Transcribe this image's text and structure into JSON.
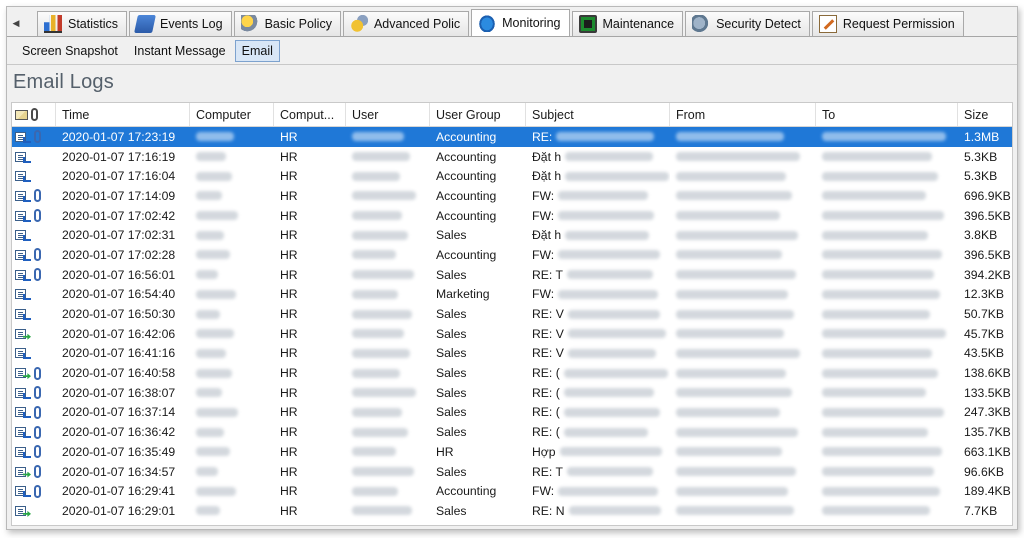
{
  "tabs": [
    {
      "label": "Statistics",
      "icon": "statistics-icon"
    },
    {
      "label": "Events Log",
      "icon": "events-log-icon"
    },
    {
      "label": "Basic Policy",
      "icon": "basic-policy-icon"
    },
    {
      "label": "Advanced Polic",
      "icon": "advanced-policy-icon"
    },
    {
      "label": "Monitoring",
      "icon": "monitoring-icon",
      "active": true
    },
    {
      "label": "Maintenance",
      "icon": "maintenance-icon"
    },
    {
      "label": "Security Detect",
      "icon": "security-detect-icon"
    },
    {
      "label": "Request Permission",
      "icon": "request-permission-icon"
    }
  ],
  "subtabs": [
    {
      "label": "Screen Snapshot"
    },
    {
      "label": "Instant Message"
    },
    {
      "label": "Email",
      "active": true
    }
  ],
  "title": "Email Logs",
  "columns": {
    "time": "Time",
    "computer": "Computer",
    "computer2": "Comput...",
    "user": "User",
    "group": "User Group",
    "subject": "Subject",
    "from": "From",
    "to": "To",
    "size": "Size"
  },
  "rows": [
    {
      "time": "2020-01-07 17:23:19",
      "computer2": "HR",
      "group": "Accounting",
      "subject_prefix": "RE: ",
      "size": "1.3MB",
      "direction": "in",
      "attachment": true,
      "selected": true
    },
    {
      "time": "2020-01-07 17:16:19",
      "computer2": "HR",
      "group": "Accounting",
      "subject_prefix": "Đặt h",
      "size": "5.3KB",
      "direction": "in",
      "attachment": false
    },
    {
      "time": "2020-01-07 17:16:04",
      "computer2": "HR",
      "group": "Accounting",
      "subject_prefix": "Đặt h",
      "size": "5.3KB",
      "direction": "in",
      "attachment": false
    },
    {
      "time": "2020-01-07 17:14:09",
      "computer2": "HR",
      "group": "Accounting",
      "subject_prefix": "FW: ",
      "size": "696.9KB",
      "direction": "in",
      "attachment": true
    },
    {
      "time": "2020-01-07 17:02:42",
      "computer2": "HR",
      "group": "Accounting",
      "subject_prefix": "FW: ",
      "size": "396.5KB",
      "direction": "in",
      "attachment": true
    },
    {
      "time": "2020-01-07 17:02:31",
      "computer2": "HR",
      "group": "Sales",
      "subject_prefix": "Đặt h",
      "size": "3.8KB",
      "direction": "in",
      "attachment": false
    },
    {
      "time": "2020-01-07 17:02:28",
      "computer2": "HR",
      "group": "Accounting",
      "subject_prefix": "FW: ",
      "size": "396.5KB",
      "direction": "in",
      "attachment": true
    },
    {
      "time": "2020-01-07 16:56:01",
      "computer2": "HR",
      "group": "Sales",
      "subject_prefix": "RE: T",
      "size": "394.2KB",
      "direction": "in",
      "attachment": true
    },
    {
      "time": "2020-01-07 16:54:40",
      "computer2": "HR",
      "group": "Marketing",
      "subject_prefix": "FW: ",
      "size": "12.3KB",
      "direction": "in",
      "attachment": false
    },
    {
      "time": "2020-01-07 16:50:30",
      "computer2": "HR",
      "group": "Sales",
      "subject_prefix": "RE: V",
      "size": "50.7KB",
      "direction": "in",
      "attachment": false
    },
    {
      "time": "2020-01-07 16:42:06",
      "computer2": "HR",
      "group": "Sales",
      "subject_prefix": "RE: V",
      "size": "45.7KB",
      "direction": "out",
      "attachment": false
    },
    {
      "time": "2020-01-07 16:41:16",
      "computer2": "HR",
      "group": "Sales",
      "subject_prefix": "RE: V",
      "size": "43.5KB",
      "direction": "in",
      "attachment": false
    },
    {
      "time": "2020-01-07 16:40:58",
      "computer2": "HR",
      "group": "Sales",
      "subject_prefix": "RE: (",
      "size": "138.6KB",
      "direction": "out",
      "attachment": true
    },
    {
      "time": "2020-01-07 16:38:07",
      "computer2": "HR",
      "group": "Sales",
      "subject_prefix": "RE: (",
      "size": "133.5KB",
      "direction": "in",
      "attachment": true
    },
    {
      "time": "2020-01-07 16:37:14",
      "computer2": "HR",
      "group": "Sales",
      "subject_prefix": "RE: (",
      "size": "247.3KB",
      "direction": "in",
      "attachment": true
    },
    {
      "time": "2020-01-07 16:36:42",
      "computer2": "HR",
      "group": "Sales",
      "subject_prefix": "RE: (",
      "size": "135.7KB",
      "direction": "in",
      "attachment": true
    },
    {
      "time": "2020-01-07 16:35:49",
      "computer2": "HR",
      "group": "HR",
      "subject_prefix": "Hợp ",
      "size": "663.1KB",
      "direction": "in",
      "attachment": true
    },
    {
      "time": "2020-01-07 16:34:57",
      "computer2": "HR",
      "group": "Sales",
      "subject_prefix": "RE: T",
      "size": "96.6KB",
      "direction": "out",
      "attachment": true
    },
    {
      "time": "2020-01-07 16:29:41",
      "computer2": "HR",
      "group": "Accounting",
      "subject_prefix": "FW: ",
      "size": "189.4KB",
      "direction": "in",
      "attachment": true
    },
    {
      "time": "2020-01-07 16:29:01",
      "computer2": "HR",
      "group": "Sales",
      "subject_prefix": "RE: N",
      "size": "7.7KB",
      "direction": "out",
      "attachment": false
    }
  ]
}
